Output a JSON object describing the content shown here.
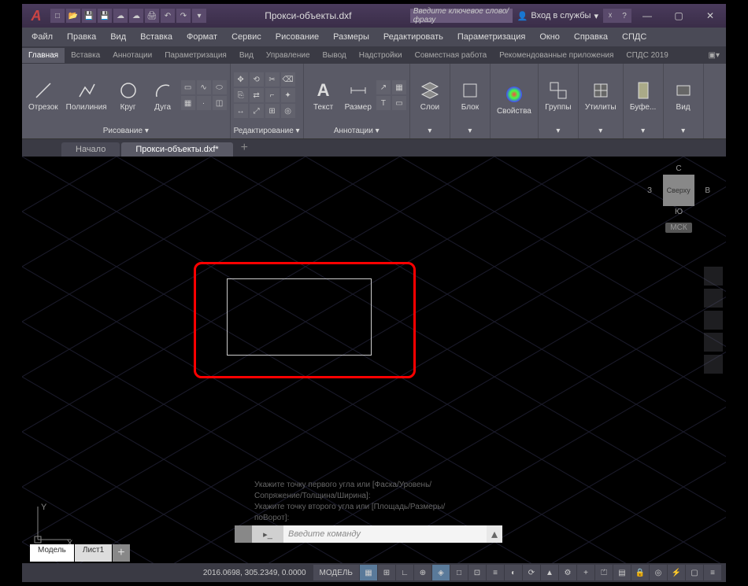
{
  "titlebar": {
    "title": "Прокси-объекты.dxf",
    "search_placeholder": "Введите ключевое слово/фразу",
    "login_label": "Вход в службы"
  },
  "menubar": [
    "Файл",
    "Правка",
    "Вид",
    "Вставка",
    "Формат",
    "Сервис",
    "Рисование",
    "Размеры",
    "Редактировать",
    "Параметризация",
    "Окно",
    "Справка",
    "СПДС"
  ],
  "ribbon_tabs": [
    "Главная",
    "Вставка",
    "Аннотации",
    "Параметризация",
    "Вид",
    "Управление",
    "Вывод",
    "Надстройки",
    "Совместная работа",
    "Рекомендованные приложения",
    "СПДС 2019"
  ],
  "active_ribbon_tab": 0,
  "panels": {
    "draw": {
      "title": "Рисование ▾",
      "buttons": [
        {
          "label": "Отрезок",
          "icon": "line"
        },
        {
          "label": "Полилиния",
          "icon": "polyline"
        },
        {
          "label": "Круг",
          "icon": "circle"
        },
        {
          "label": "Дуга",
          "icon": "arc"
        }
      ]
    },
    "modify": {
      "title": "Редактирование ▾"
    },
    "annotation": {
      "title": "Аннотации ▾",
      "buttons": [
        {
          "label": "Текст",
          "icon": "A"
        },
        {
          "label": "Размер",
          "icon": "dim"
        }
      ]
    },
    "layers": {
      "title": "▾",
      "buttons": [
        {
          "label": "Слои",
          "icon": "layers"
        }
      ]
    },
    "block": {
      "title": "▾",
      "buttons": [
        {
          "label": "Блок",
          "icon": "block"
        }
      ]
    },
    "properties": {
      "title": "",
      "buttons": [
        {
          "label": "Свойства",
          "icon": "props"
        }
      ]
    },
    "groups": {
      "title": "▾",
      "buttons": [
        {
          "label": "Группы",
          "icon": "group"
        }
      ]
    },
    "utilities": {
      "title": "▾",
      "buttons": [
        {
          "label": "Утилиты",
          "icon": "util"
        }
      ]
    },
    "clipboard": {
      "title": "▾",
      "buttons": [
        {
          "label": "Буфе...",
          "icon": "clip"
        }
      ]
    },
    "view": {
      "title": "▾",
      "buttons": [
        {
          "label": "Вид",
          "icon": "view"
        }
      ]
    }
  },
  "file_tabs": [
    {
      "label": "Начало",
      "active": false
    },
    {
      "label": "Прокси-объекты.dxf*",
      "active": true
    }
  ],
  "viewcube": {
    "top": "С",
    "bottom": "Ю",
    "left": "З",
    "right": "В",
    "face": "Сверху",
    "wcs": "МСК"
  },
  "ucs": {
    "x": "X",
    "y": "Y"
  },
  "cmd_history": [
    "Укажите точку первого угла или [Фаска/Уровень/",
    "Сопряжение/Толщина/Ширина]:",
    "Укажите точку второго угла или [Площадь/Размеры/",
    "поВорот]:"
  ],
  "cmd_input_placeholder": "Введите команду",
  "cmd_prompt": "▸_",
  "model_tabs": [
    {
      "label": "Модель",
      "active": true
    },
    {
      "label": "Лист1",
      "active": false
    }
  ],
  "statusbar": {
    "coords": "2016.0698, 305.2349, 0.0000",
    "model_label": "МОДЕЛЬ"
  }
}
